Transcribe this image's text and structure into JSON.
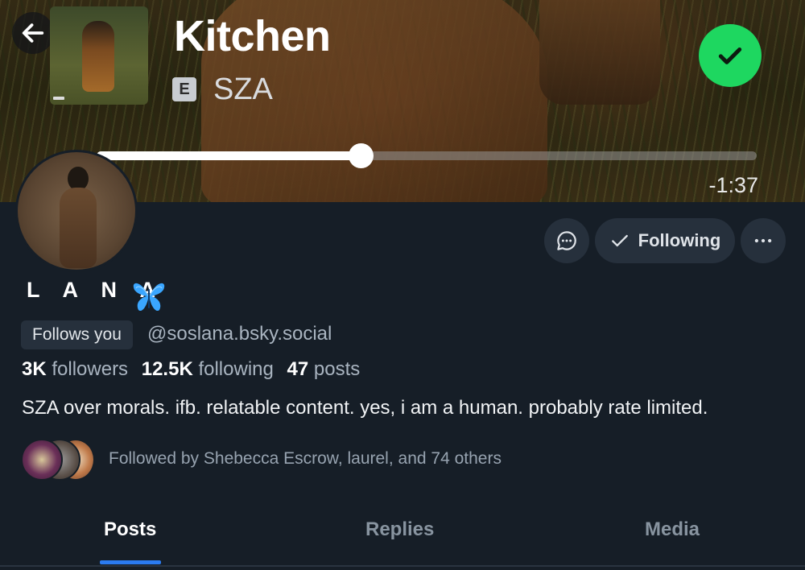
{
  "player": {
    "song_title": "Kitchen",
    "explicit_label": "E",
    "artist": "SZA",
    "time_remaining": "-1:37",
    "progress": 0.4,
    "check_color": "#1ed760"
  },
  "profile": {
    "display_name": "L A N A",
    "follows_you": "Follows you",
    "handle": "@soslana.bsky.social",
    "stats": {
      "followers_count": "3K",
      "followers_label": "followers",
      "following_count": "12.5K",
      "following_label": "following",
      "posts_count": "47",
      "posts_label": "posts"
    },
    "bio": "SZA over morals. ifb. relatable content. yes, i am a human. probably rate limited.",
    "followed_by": "Followed by Shebecca Escrow, laurel, and 74 others"
  },
  "actions": {
    "following_label": "Following",
    "message_icon": "chat-bubble-icon",
    "more_icon": "more-horizontal-icon"
  },
  "tabs": [
    {
      "label": "Posts",
      "active": true
    },
    {
      "label": "Replies",
      "active": false
    },
    {
      "label": "Media",
      "active": false
    }
  ],
  "colors": {
    "background": "#161e27",
    "button_bg": "#26303c",
    "accent": "#2b7bf0"
  }
}
